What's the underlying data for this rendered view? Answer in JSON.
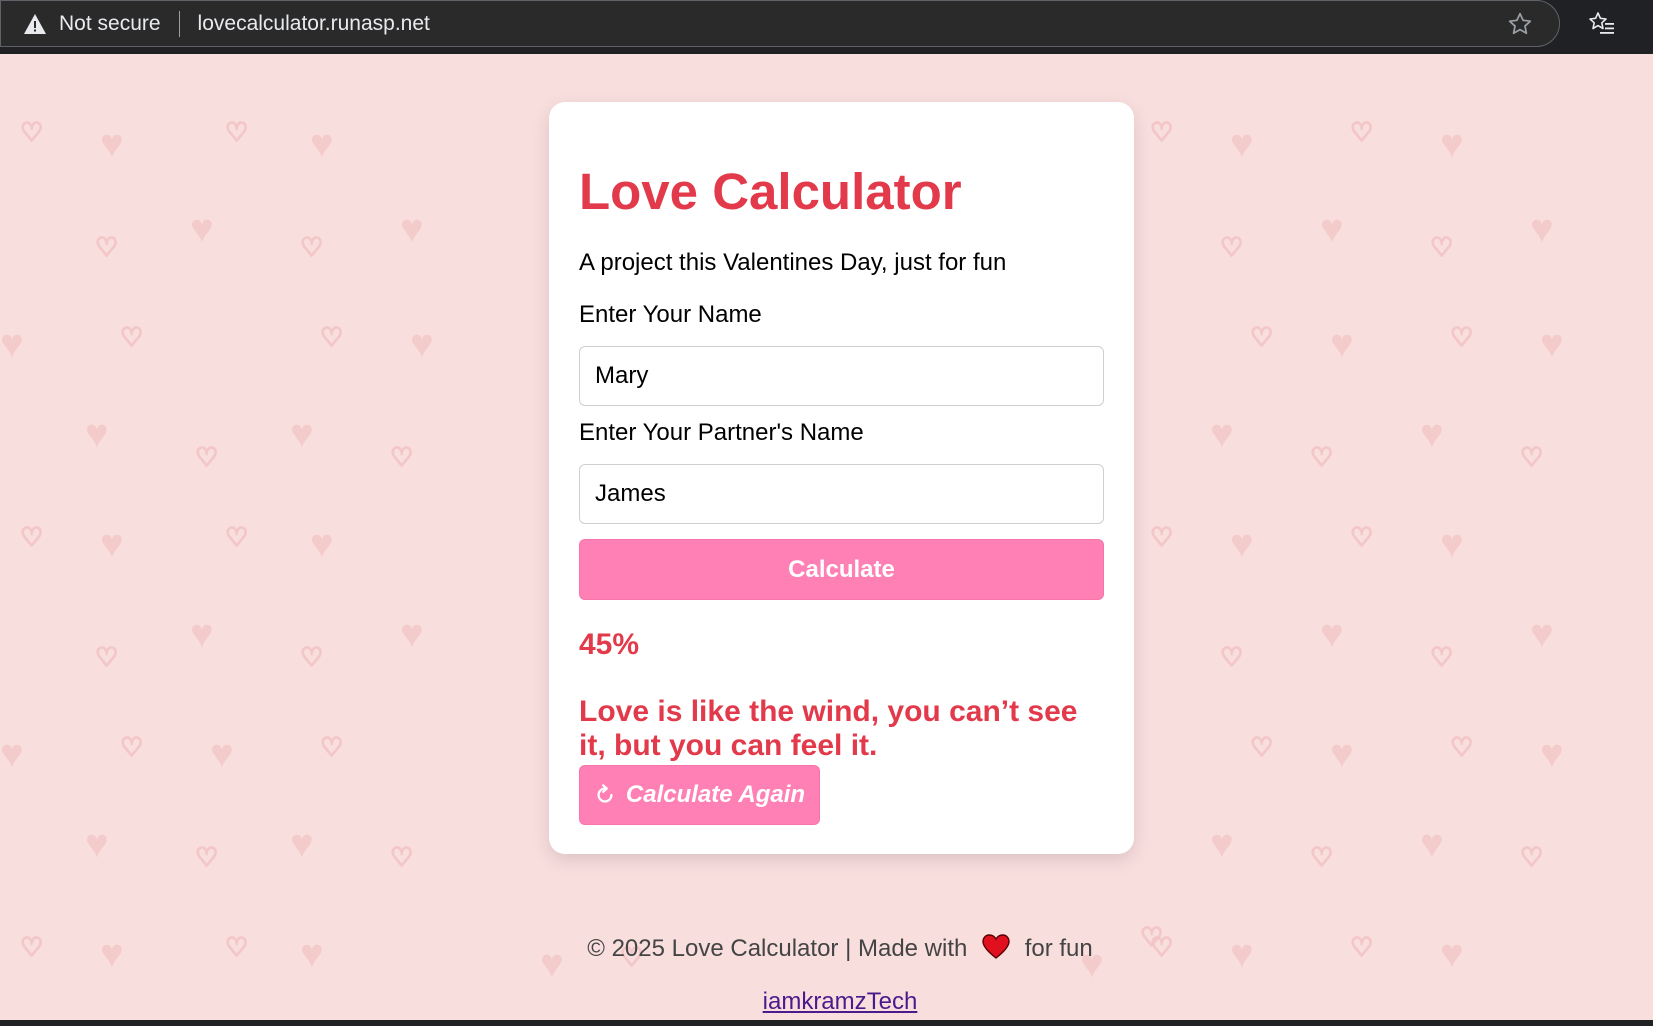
{
  "browser": {
    "security_label": "Not secure",
    "url": "lovecalculator.runasp.net"
  },
  "card": {
    "title": "Love Calculator",
    "subtitle": "A project this Valentines Day, just for fun",
    "name_label": "Enter Your Name",
    "name_value": "Mary",
    "partner_label": "Enter Your Partner's Name",
    "partner_value": "James",
    "calculate_label": "Calculate",
    "result_percent": "45%",
    "result_quote": "Love is like the wind, you can’t see it, but you can feel it.",
    "again_label": "Calculate Again"
  },
  "footer": {
    "left_text": "© 2025 Love Calculator | Made with",
    "right_text": "for fun",
    "credit_link": "iamkramzTech"
  },
  "colors": {
    "accent": "#e23a4b",
    "button": "#ff80b5",
    "background": "#f9dede"
  },
  "icons": [
    "warning-icon",
    "star-icon",
    "favorites-icon",
    "refresh-icon",
    "heart-icon"
  ]
}
